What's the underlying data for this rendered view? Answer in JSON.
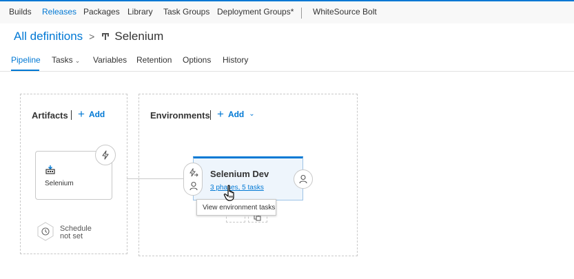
{
  "topnav": {
    "tabs": [
      {
        "label": "Builds"
      },
      {
        "label": "Releases",
        "active": true
      },
      {
        "label": "Packages"
      },
      {
        "label": "Library"
      },
      {
        "label": "Task Groups"
      },
      {
        "label": "Deployment Groups*"
      },
      {
        "label": "WhiteSource Bolt"
      }
    ],
    "accent": "#0078d4"
  },
  "breadcrumb": {
    "parent": "All definitions",
    "separator": ">",
    "icon": "release-definition-icon",
    "title": "Selenium"
  },
  "subtabs": [
    {
      "label": "Pipeline",
      "active": true
    },
    {
      "label": "Tasks",
      "has_dropdown": true
    },
    {
      "label": "Variables"
    },
    {
      "label": "Retention"
    },
    {
      "label": "Options"
    },
    {
      "label": "History"
    }
  ],
  "artifacts": {
    "title": "Artifacts",
    "add_label": "Add",
    "card": {
      "label": "Selenium",
      "icon": "build-artifact-icon",
      "trigger_icon": "lightning-icon"
    },
    "schedule": {
      "line1": "Schedule",
      "line2": "not set",
      "icon": "clock-icon"
    }
  },
  "environments": {
    "title": "Environments",
    "add_label": "Add",
    "card": {
      "name": "Selenium Dev",
      "summary": "3 phases, 5 tasks",
      "pre_icons": [
        "pre-deployment-conditions-icon",
        "pre-deployment-approvers-icon"
      ],
      "post_icon": "post-deployment-approvers-icon"
    },
    "tooltip": "View environment tasks"
  }
}
